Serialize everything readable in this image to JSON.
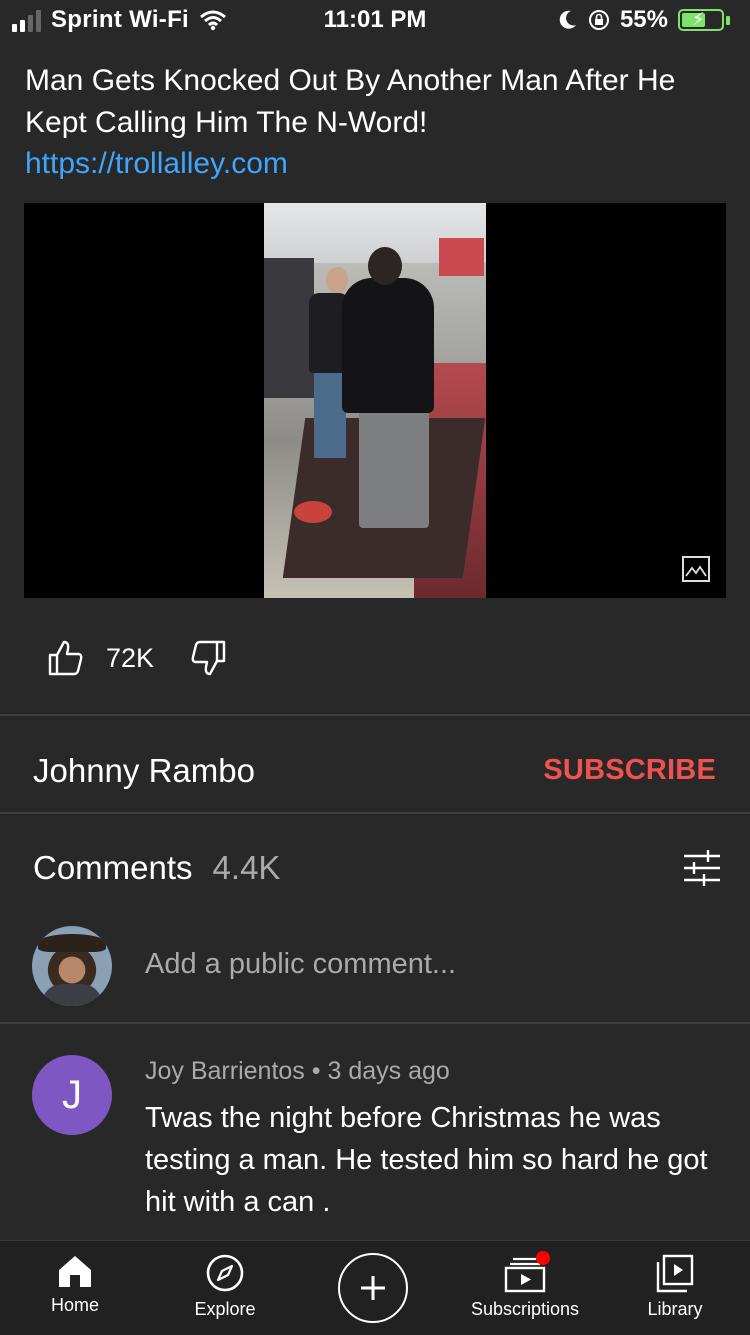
{
  "status_bar": {
    "carrier": "Sprint Wi-Fi",
    "time": "11:01 PM",
    "battery": "55%"
  },
  "post": {
    "title": "Man Gets Knocked Out By Another Man After He Kept Calling Him The N-Word!",
    "link": "https://trollalley.com",
    "likes": "72K"
  },
  "channel": {
    "name": "Johnny Rambo",
    "subscribe_label": "SUBSCRIBE"
  },
  "comments": {
    "label": "Comments",
    "count": "4.4K",
    "add_placeholder": "Add a public comment...",
    "items": [
      {
        "initial": "J",
        "author": "Joy Barrientos",
        "separator": "•",
        "time": "3 days ago",
        "text": "Twas the night before Christmas he was testing a man. He tested him so hard he got hit with a can ."
      }
    ]
  },
  "nav": {
    "home": "Home",
    "explore": "Explore",
    "subscriptions": "Subscriptions",
    "library": "Library"
  },
  "colors": {
    "background": "#282828",
    "link": "#3ea6ff",
    "subscribe": "#f1514f",
    "avatar": "#7e57c2"
  }
}
